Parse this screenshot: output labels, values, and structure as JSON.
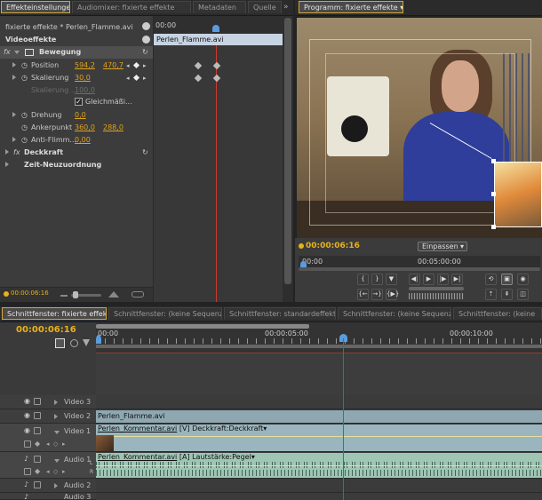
{
  "effects_panel": {
    "tabs": [
      "Effekteinstellungen",
      "Audiomixer: fixierte effekte",
      "Metadaten",
      "Quelle"
    ],
    "tab_close": "×",
    "breadcrumb": "fixierte effekte * Perlen_Flamme.avi",
    "mini_timecode": "00:00",
    "clip_label": "Perlen_Flamme.avi",
    "section_video": "Videoeffekte",
    "motion_label": "Bewegung",
    "position_label": "Position",
    "position_x": "594,2",
    "position_y": "470,7",
    "scale_label": "Skalierung",
    "scale_value": "30,0",
    "scale_width_label": "Skalierung ...",
    "scale_width_value": "100,0",
    "uniform_label": "Gleichmäßi...",
    "rotation_label": "Drehung",
    "rotation_value": "0,0",
    "anchor_label": "Ankerpunkt",
    "anchor_x": "360,0",
    "anchor_y": "288,0",
    "flicker_label": "Anti-Flimm...",
    "flicker_value": "0,00",
    "opacity_label": "Deckkraft",
    "time_remap_label": "Zeit-Neuzuordnung",
    "footer_timecode": "00:00:06:16"
  },
  "program_monitor": {
    "tab": "Programm: fixierte effekte",
    "timecode": "00:00:06:16",
    "fit_dropdown": "Einpassen",
    "ruler_start": "00:00",
    "ruler_mid": "00:05:00:00"
  },
  "timeline": {
    "tabs": [
      "Schnittfenster: fixierte effekte",
      "Schnittfenster: (keine Sequenzen)",
      "Schnittfenster: standardeffekte",
      "Schnittfenster: (keine Sequenzen)",
      "Schnittfenster: (keine"
    ],
    "timecode": "00:00:06:16",
    "ruler_labels": [
      "00:00",
      "00:00:05:00",
      "00:00:10:00"
    ],
    "tracks": {
      "video3": "Video 3",
      "video2": "Video 2",
      "video1": "Video 1",
      "audio1": "Audio 1",
      "audio2": "Audio 2",
      "audio3": "Audio 3"
    },
    "clip_v2": "Perlen_Flamme.avi",
    "clip_v1": "Perlen_Kommentar.avi",
    "clip_v1_suffix": "[V]",
    "clip_v1_fx": "Deckkraft:Deckkraft",
    "clip_a1": "Perlen_Kommentar.avi",
    "clip_a1_suffix": "[A]",
    "clip_a1_fx": "Lautstärke:Pegel",
    "channel_l": "L",
    "channel_r": "R"
  },
  "glyphs": {
    "fx": "fx",
    "check": "✓",
    "stopwatch": "◷",
    "reset": "↻",
    "eye": "◉",
    "speaker": "♪",
    "play": "▶",
    "step_back": "◀|",
    "step_fwd": "|▶",
    "mark_in": "{",
    "mark_out": "}",
    "dropdown": "▾"
  }
}
